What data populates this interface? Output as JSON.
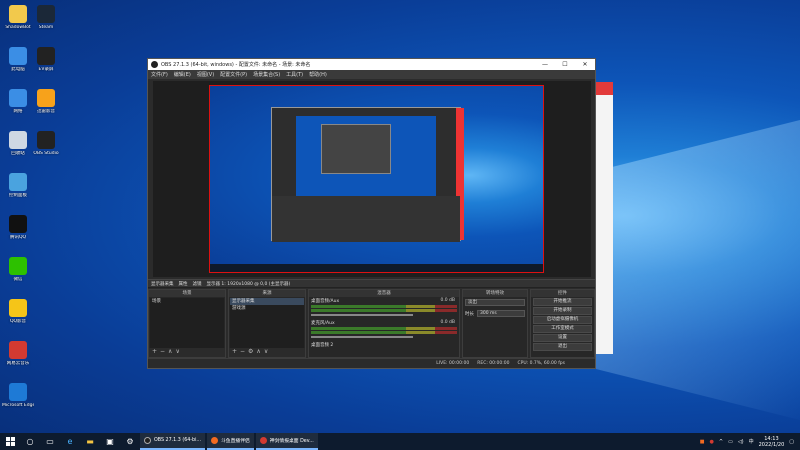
{
  "desktop": {
    "icons": [
      {
        "label": "ShadowBot",
        "color": "#f2c94c"
      },
      {
        "label": "Steam",
        "color": "#1b2838"
      },
      {
        "label": "此电脑",
        "color": "#3b8ee5"
      },
      {
        "label": "EV录屏",
        "color": "#222222"
      },
      {
        "label": "网络",
        "color": "#3b8ee5"
      },
      {
        "label": "迅雷影音",
        "color": "#f7a21b"
      },
      {
        "label": "回收站",
        "color": "#cfd8e3"
      },
      {
        "label": "OBS Studio",
        "color": "#222222"
      },
      {
        "label": "控制面板",
        "color": "#4aa3df"
      },
      {
        "label": "腾讯QQ",
        "color": "#111111"
      },
      {
        "label": "微信",
        "color": "#2dc100"
      },
      {
        "label": "QQ影音",
        "color": "#f5c518"
      },
      {
        "label": "网易云音乐",
        "color": "#d33a31"
      },
      {
        "label": "Microsoft Edge",
        "color": "#1e7ad6"
      }
    ]
  },
  "obs": {
    "title": "OBS 27.1.3 (64-bit, windows) - 配置文件: 未命名 - 场景: 未命名",
    "window_controls": [
      "—",
      "☐",
      "✕"
    ],
    "menu": [
      "文件(F)",
      "编辑(E)",
      "视图(V)",
      "配置文件(P)",
      "场景集合(S)",
      "工具(T)",
      "帮助(H)"
    ],
    "source_bar": {
      "source": "显示器采集",
      "properties": "属性",
      "filters": "滤镜",
      "display": "显示器 1: 1920x1080 @ 0,0 (主显示器)"
    },
    "docks": {
      "scenes": {
        "title": "场景",
        "items": [
          "场景"
        ]
      },
      "sources": {
        "title": "来源",
        "items": [
          "显示器采集",
          "游戏源"
        ]
      },
      "mixer": {
        "title": "混音器",
        "channels": [
          {
            "name": "桌面音频/Aux",
            "db": "0.0 dB"
          },
          {
            "name": "麦克风/Aux",
            "db": "0.0 dB"
          },
          {
            "name": "桌面音频 2",
            "db": ""
          }
        ]
      },
      "transitions": {
        "title": "转场特效",
        "type": "淡出",
        "duration_label": "时长",
        "duration_value": "300 ms"
      },
      "controls": {
        "title": "控件",
        "buttons": [
          "开始推流",
          "开始录制",
          "启动虚拟摄像机",
          "工作室模式",
          "设置",
          "退出"
        ]
      }
    },
    "status": {
      "live": "LIVE: 00:00:00",
      "rec": "REC: 00:00:00",
      "cpu": "CPU: 0.7%, 60.00 fps"
    }
  },
  "taskbar": {
    "start_icon": "windows-logo",
    "apps": [
      {
        "label": "OBS 27.1.3 (64-bi...",
        "color": "#222222"
      },
      {
        "label": "斗鱼直播伴侣",
        "color": "#f26a21"
      },
      {
        "label": "神剑情报桌面 Dev...",
        "color": "#d33a31"
      }
    ],
    "tray": {
      "ime": "中",
      "time": "14:13",
      "date": "2022/1/20"
    }
  }
}
